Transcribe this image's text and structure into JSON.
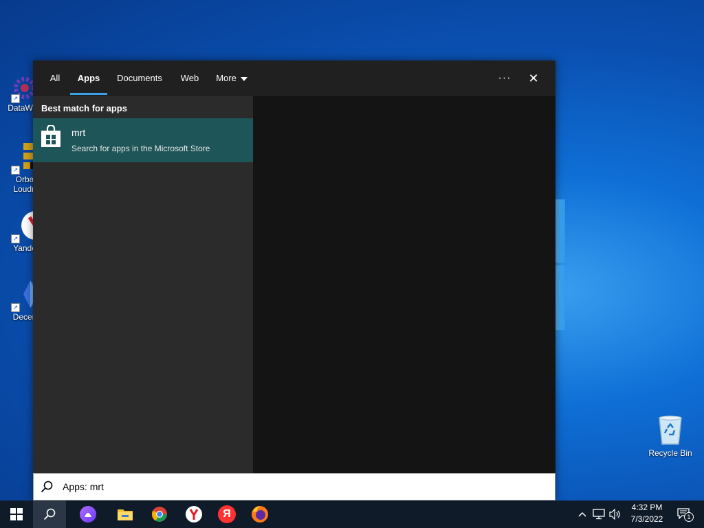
{
  "desktop": {
    "icons": [
      {
        "label": "DataWag"
      },
      {
        "label": "Orba Loudn"
      },
      {
        "label": "Yande"
      },
      {
        "label": "Decen"
      },
      {
        "label": "Recycle Bin"
      }
    ]
  },
  "search": {
    "tabs": [
      {
        "label": "All"
      },
      {
        "label": "Apps"
      },
      {
        "label": "Documents"
      },
      {
        "label": "Web"
      },
      {
        "label": "More"
      }
    ],
    "active_tab": "Apps",
    "section_header": "Best match for apps",
    "result": {
      "title": "mrt",
      "subtitle": "Search for apps in the Microsoft Store"
    },
    "query": "Apps: mrt",
    "more_options_symbol": "···",
    "close_symbol": "✕"
  },
  "taskbar": {
    "time": "4:32 PM",
    "date": "7/3/2022",
    "notification_count": "1",
    "yandex_browser_glyph": "Я"
  },
  "colors": {
    "accent": "#3aa0e8",
    "result_highlight": "#1e5559",
    "taskbar": "#101b2a"
  }
}
